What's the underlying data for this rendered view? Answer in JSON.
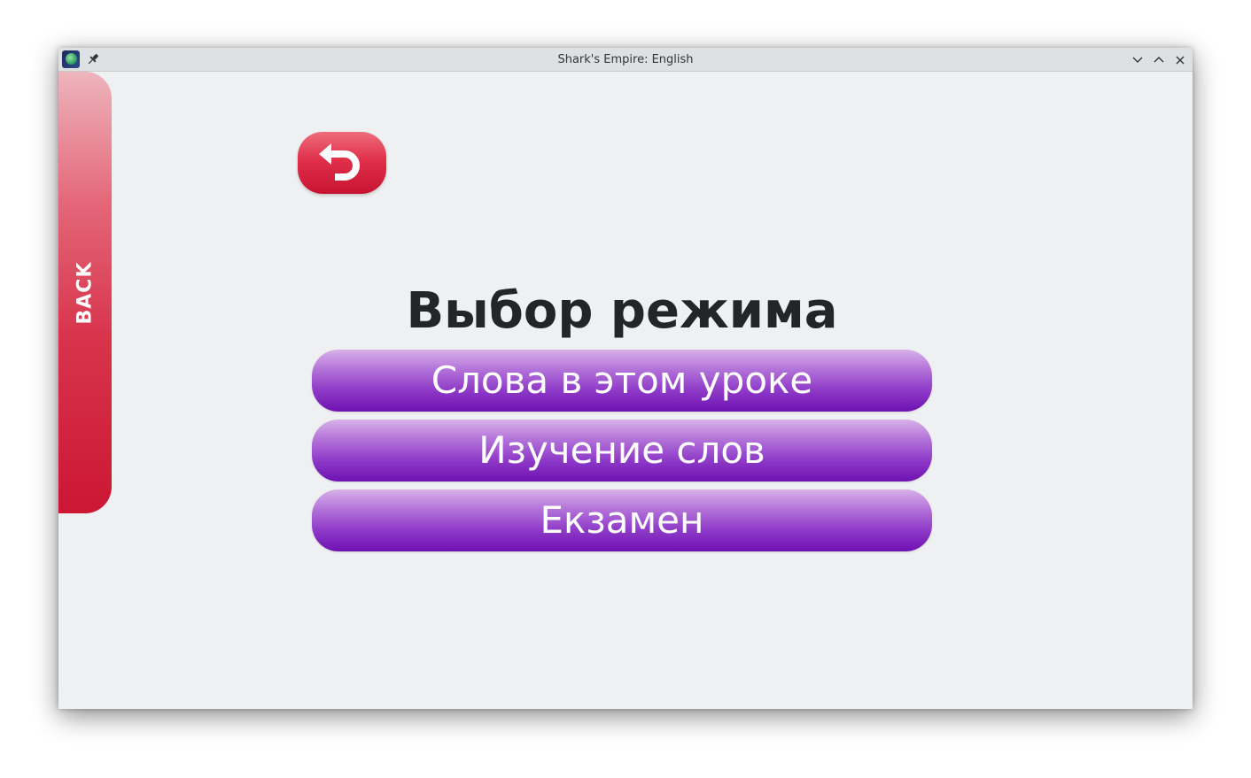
{
  "window": {
    "title": "Shark's Empire: English"
  },
  "sidebar": {
    "back_label": "BACK"
  },
  "main": {
    "title": "Выбор режима",
    "buttons": [
      {
        "label": "Слова в этом уроке"
      },
      {
        "label": "Изучение слов"
      },
      {
        "label": "Екзамен"
      }
    ]
  },
  "icons": {
    "app": "app-icon",
    "pin": "pin-icon",
    "minimize": "chevron-down-icon",
    "maximize": "chevron-up-icon",
    "close": "close-icon",
    "undo": "undo-arrow-icon"
  },
  "colors": {
    "back_red": "#cb1733",
    "button_purple": "#6e11b2",
    "background": "#eff0f1",
    "title_text": "#232629"
  }
}
